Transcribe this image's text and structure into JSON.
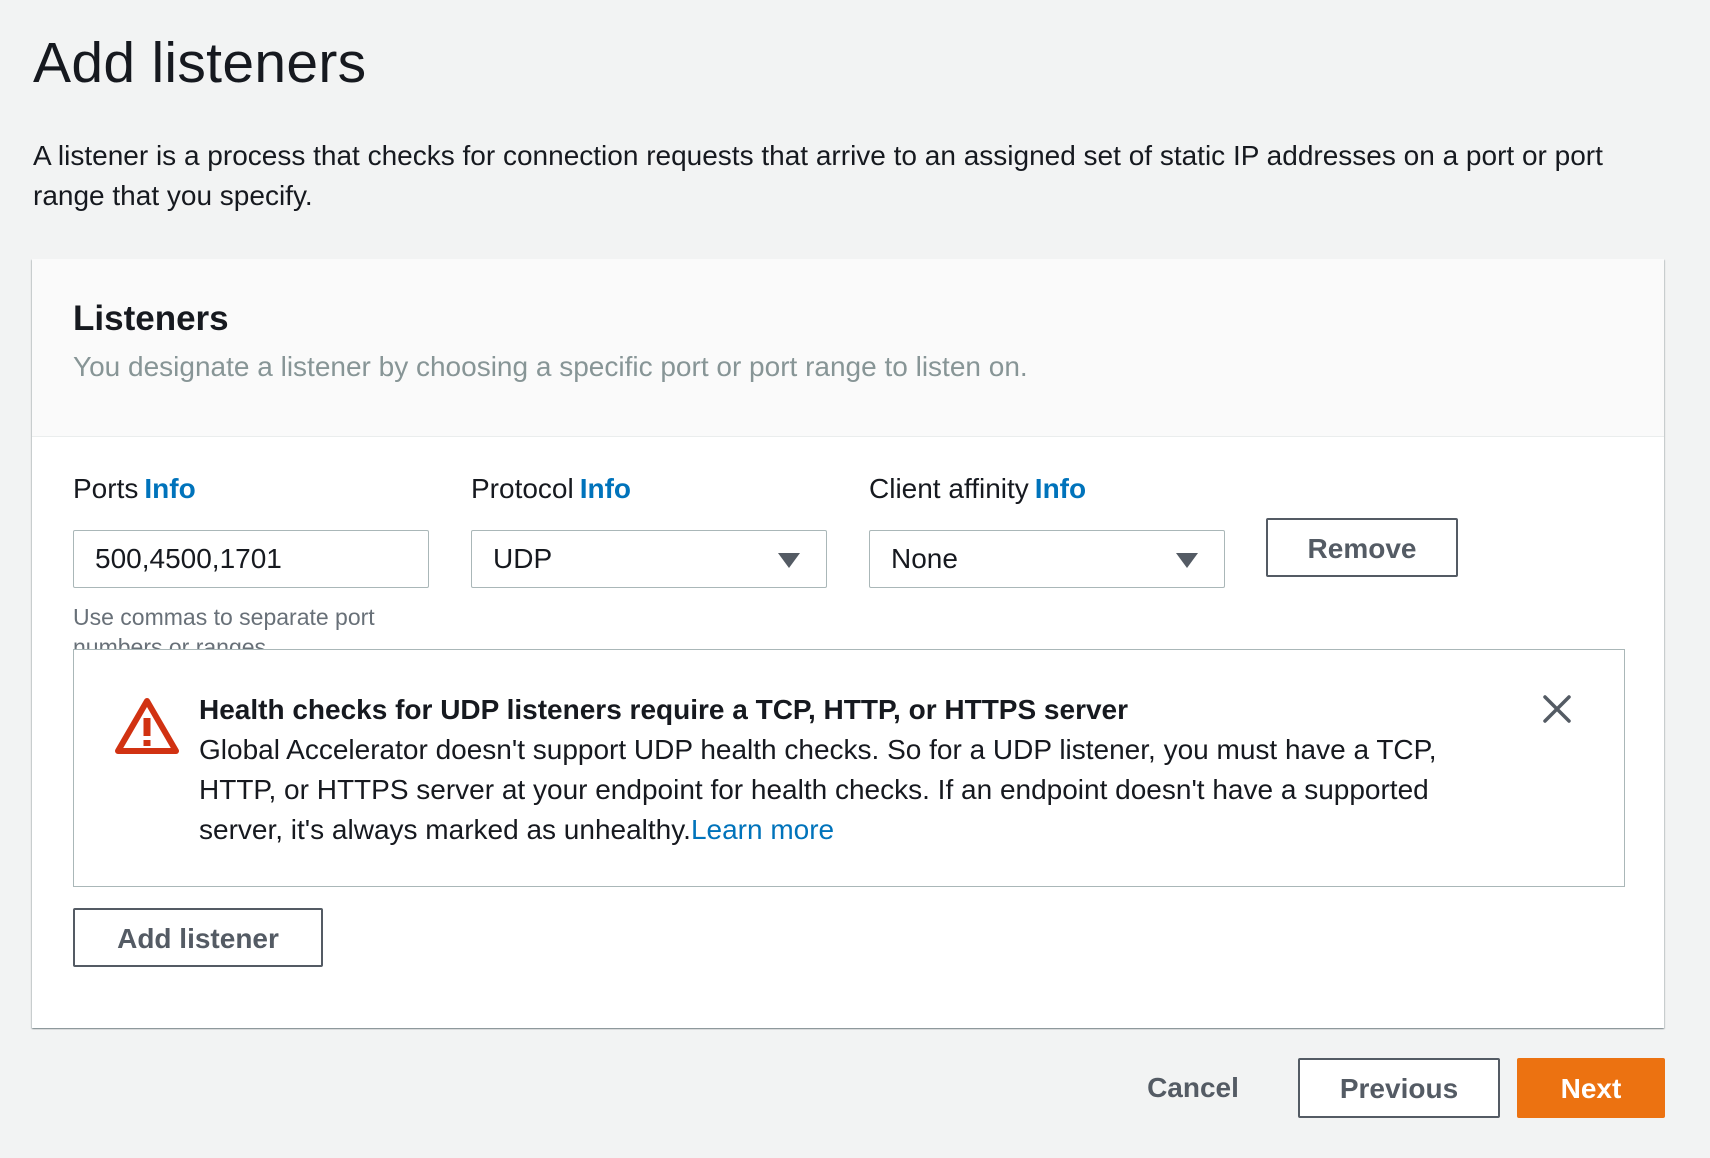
{
  "page": {
    "title": "Add listeners",
    "description": "A listener is a process that checks for connection requests that arrive to an assigned set of static IP addresses on a port or port range that you specify."
  },
  "listeners_section": {
    "title": "Listeners",
    "description": "You designate a listener by choosing a specific port or port range to listen on.",
    "ports": {
      "label": "Ports",
      "info": "Info",
      "value": "500,4500,1701",
      "hint": "Use commas to separate port numbers or ranges."
    },
    "protocol": {
      "label": "Protocol",
      "info": "Info",
      "selected": "UDP"
    },
    "client_affinity": {
      "label": "Client affinity",
      "info": "Info",
      "selected": "None"
    },
    "remove_label": "Remove",
    "alert": {
      "title": "Health checks for UDP listeners require a TCP, HTTP, or HTTPS server",
      "body": "Global Accelerator doesn't support UDP health checks. So for a UDP listener, you must have a TCP, HTTP, or HTTPS server at your endpoint for health checks. If an endpoint doesn't have a supported server, it's always marked as unhealthy.",
      "link": "Learn more",
      "icon": "warning-icon",
      "color": "#d13212"
    },
    "add_listener_label": "Add listener"
  },
  "footer": {
    "cancel_label": "Cancel",
    "previous_label": "Previous",
    "next_label": "Next",
    "next_color": "#ec7211"
  }
}
